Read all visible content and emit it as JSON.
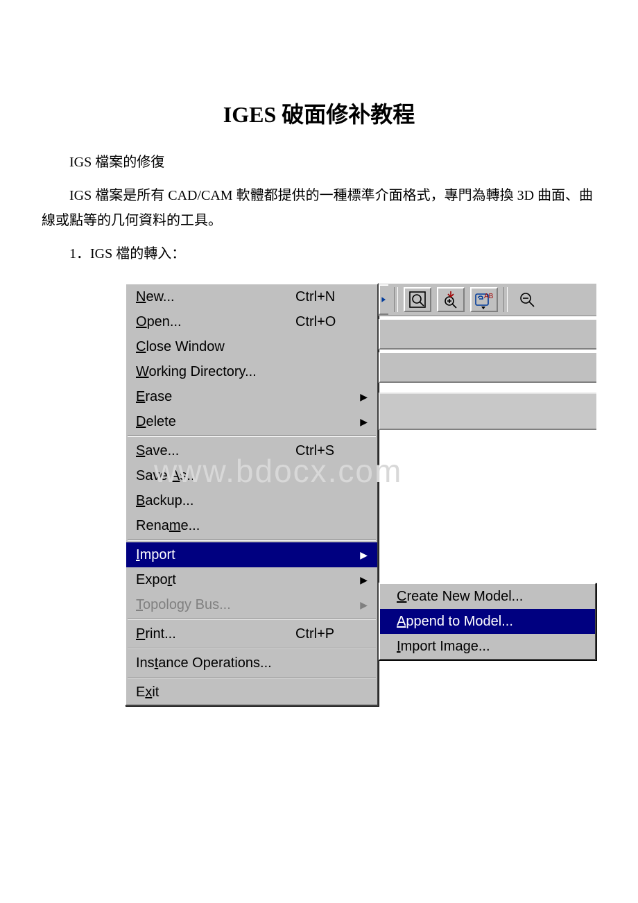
{
  "doc": {
    "title": "IGES 破面修补教程",
    "paragraphs": {
      "p1": "IGS 檔案的修復",
      "p2": "IGS 檔案是所有 CAD/CAM 軟體都提供的一種標準介面格式，專門為轉換 3D 曲面、曲線或點等的几何資料的工具。",
      "p3": "1．IGS 檔的轉入："
    },
    "watermark": "www.bdocx.com"
  },
  "menu": {
    "main": [
      {
        "l1": "N",
        "rest": "ew...",
        "accel": "Ctrl+N",
        "arrow": false,
        "disabled": false
      },
      {
        "l1": "O",
        "rest": "pen...",
        "accel": "Ctrl+O",
        "arrow": false,
        "disabled": false
      },
      {
        "l1": "C",
        "rest": "lose Window",
        "accel": "",
        "arrow": false,
        "disabled": false
      },
      {
        "l1": "W",
        "rest": "orking Directory...",
        "accel": "",
        "arrow": false,
        "disabled": false
      },
      {
        "l1": "E",
        "rest": "rase",
        "accel": "",
        "arrow": true,
        "disabled": false
      },
      {
        "l1": "D",
        "rest": "elete",
        "accel": "",
        "arrow": true,
        "disabled": false
      },
      {
        "sep": true
      },
      {
        "l1": "S",
        "rest": "ave...",
        "accel": "Ctrl+S",
        "arrow": false,
        "disabled": false
      },
      {
        "pre": "Save ",
        "l1": "A",
        "rest": "s...",
        "accel": "",
        "arrow": false,
        "disabled": false
      },
      {
        "l1": "B",
        "rest": "ackup...",
        "accel": "",
        "arrow": false,
        "disabled": false
      },
      {
        "pre": "Rena",
        "l1": "m",
        "rest": "e...",
        "accel": "",
        "arrow": false,
        "disabled": false
      },
      {
        "sep": true
      },
      {
        "l1": "I",
        "rest": "mport",
        "accel": "",
        "arrow": true,
        "disabled": false,
        "highlight": true
      },
      {
        "pre": "Expo",
        "l1": "r",
        "rest": "t",
        "accel": "",
        "arrow": true,
        "disabled": false
      },
      {
        "l1": "T",
        "rest": "opology Bus...",
        "accel": "",
        "arrow": true,
        "disabled": true
      },
      {
        "sep": true
      },
      {
        "l1": "P",
        "rest": "rint...",
        "accel": "Ctrl+P",
        "arrow": false,
        "disabled": false
      },
      {
        "sep": true
      },
      {
        "pre": "Ins",
        "l1": "t",
        "rest": "ance Operations...",
        "accel": "",
        "arrow": false,
        "disabled": false
      },
      {
        "sep": true
      },
      {
        "pre": "E",
        "l1": "x",
        "rest": "it",
        "accel": "",
        "arrow": false,
        "disabled": false
      }
    ],
    "submenu": [
      {
        "l1": "C",
        "rest": "reate New Model...",
        "highlight": false
      },
      {
        "l1": "A",
        "rest": "ppend to Model...",
        "highlight": true
      },
      {
        "l1": "I",
        "rest": "mport Image...",
        "highlight": false
      }
    ]
  },
  "toolbar": {
    "icons": [
      "play-right",
      "zoom-box",
      "zoom-in-arrow",
      "ab-settings",
      "zoom-out"
    ]
  }
}
